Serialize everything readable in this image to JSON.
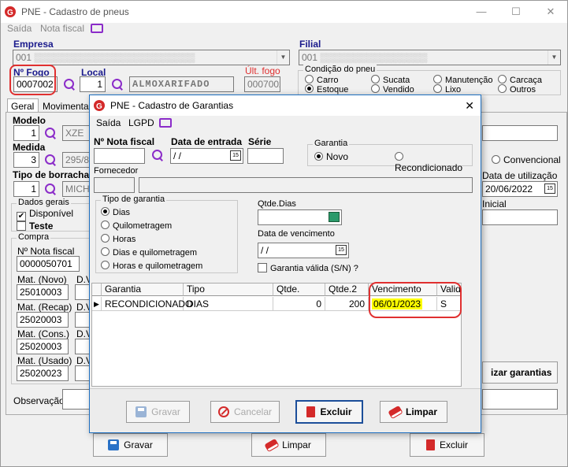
{
  "main": {
    "title": "PNE - Cadastro de pneus",
    "menu": [
      "Saída",
      "Nota fiscal"
    ],
    "empresa_label": "Empresa",
    "empresa_value": "001",
    "empresa_blur": "▒▒▒▒▒▒▒▒▒▒▒▒▒▒▒▒▒▒▒▒▒▒▒▒",
    "filial_label": "Filial",
    "filial_value": "001",
    "filial_blur": "▒▒▒▒▒▒▒▒▒▒▒▒▒▒▒▒",
    "fogo_label": "Nº Fogo",
    "fogo_value": "0007002",
    "local_label": "Local",
    "local_code": "1",
    "local_name": "ALMOXARIFADO",
    "ult_fogo_label": "Últ. fogo",
    "ult_fogo_value": "0007002",
    "condicao_label": "Condição do pneu",
    "condicao_options": [
      "Carro",
      "Sucata",
      "Manutenção",
      "Carcaça",
      "Estoque",
      "Vendido",
      "Lixo",
      "Outros"
    ],
    "condicao_selected": "Estoque",
    "tabs": [
      "Geral",
      "Movimentação"
    ],
    "modelo_label": "Modelo",
    "modelo_code": "1",
    "modelo_name": "XZE",
    "medida_label": "Medida",
    "medida_code": "3",
    "medida_name": "295/8",
    "tipo_borracha_label": "Tipo de borracha",
    "tipo_borracha_code": "1",
    "tipo_borracha_name": "MICH",
    "dados_gerais_label": "Dados gerais",
    "disponivel_label": "Disponível",
    "teste_label": "Teste",
    "convencional_label": "Convencional",
    "data_utilizacao_label": "Data de utilização",
    "data_utilizacao_value": "20/06/2022",
    "inicial_label": "Inicial",
    "compra_label": "Compra",
    "nota_fiscal_label": "Nº Nota fiscal",
    "nota_fiscal_value": "0000050701",
    "mat_novo_label": "Mat. (Novo)",
    "mat_novo_value": "25010003",
    "mat_recap_label": "Mat. (Recap)",
    "mat_recap_value": "25020003",
    "mat_cons_label": "Mat. (Cons.)",
    "mat_cons_value": "25020003",
    "mat_usado_label": "Mat. (Usado)",
    "mat_usado_value": "25020023",
    "dv_label": "D.V",
    "utilizar_garantias": "izar garantias",
    "observacao_label": "Observação",
    "btn_gravar": "Gravar",
    "btn_limpar": "Limpar",
    "btn_excluir": "Excluir"
  },
  "dialog": {
    "title": "PNE - Cadastro de Garantias",
    "menu": [
      "Saída",
      "LGPD"
    ],
    "nota_fiscal_label": "Nº Nota fiscal",
    "data_entrada_label": "Data de entrada",
    "data_entrada_value": " / /",
    "serie_label": "Série",
    "garantia_label": "Garantia",
    "garantia_novo": "Novo",
    "garantia_recond": "Recondicionado",
    "fornecedor_label": "Fornecedor",
    "tipo_garantia_label": "Tipo de garantia",
    "tipo_options": [
      "Dias",
      "Quilometragem",
      "Horas",
      "Dias e quilometragem",
      "Horas e quilometragem"
    ],
    "tipo_selected": "Dias",
    "qtde_dias_label": "Qtde.Dias",
    "data_vencimento_label": "Data de vencimento",
    "data_vencimento_value": " / /",
    "garantia_valida_label": "Garantia válida (S/N) ?",
    "columns": [
      "Garantia",
      "Tipo",
      "Qtde.",
      "Qtde.2",
      "Vencimento",
      "Valida"
    ],
    "rows": [
      {
        "garantia": "RECONDICIONADO",
        "tipo": "DIAS",
        "qtde": "0",
        "qtde2": "200",
        "vencimento": "06/01/2023",
        "valida": "S"
      }
    ],
    "btn_gravar": "Gravar",
    "btn_cancelar": "Cancelar",
    "btn_excluir": "Excluir",
    "btn_limpar": "Limpar"
  },
  "colors": {
    "accent": "#1e6fc0",
    "highlight": "#ffff00",
    "annotation": "#e03030",
    "icon": "#8b2cc9"
  }
}
